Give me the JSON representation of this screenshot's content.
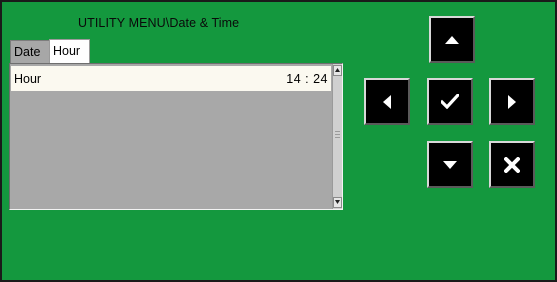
{
  "window": {
    "title": "UTILITY MENU\\Date & Time"
  },
  "tabs": [
    {
      "label": "Date",
      "selected": false
    },
    {
      "label": "Hour",
      "selected": true
    }
  ],
  "list": {
    "rows": [
      {
        "label": "Hour",
        "value": "14 : 24"
      }
    ]
  },
  "keypad": {
    "up": "triangle-up-icon",
    "left": "triangle-left-icon",
    "confirm": "checkmark-icon",
    "right": "triangle-right-icon",
    "down": "triangle-down-icon",
    "cancel": "cross-icon"
  },
  "colors": {
    "background": "#14983e",
    "list_background": "#a8a8a8",
    "selected_row": "#fbf9f0",
    "key": "#000000"
  }
}
